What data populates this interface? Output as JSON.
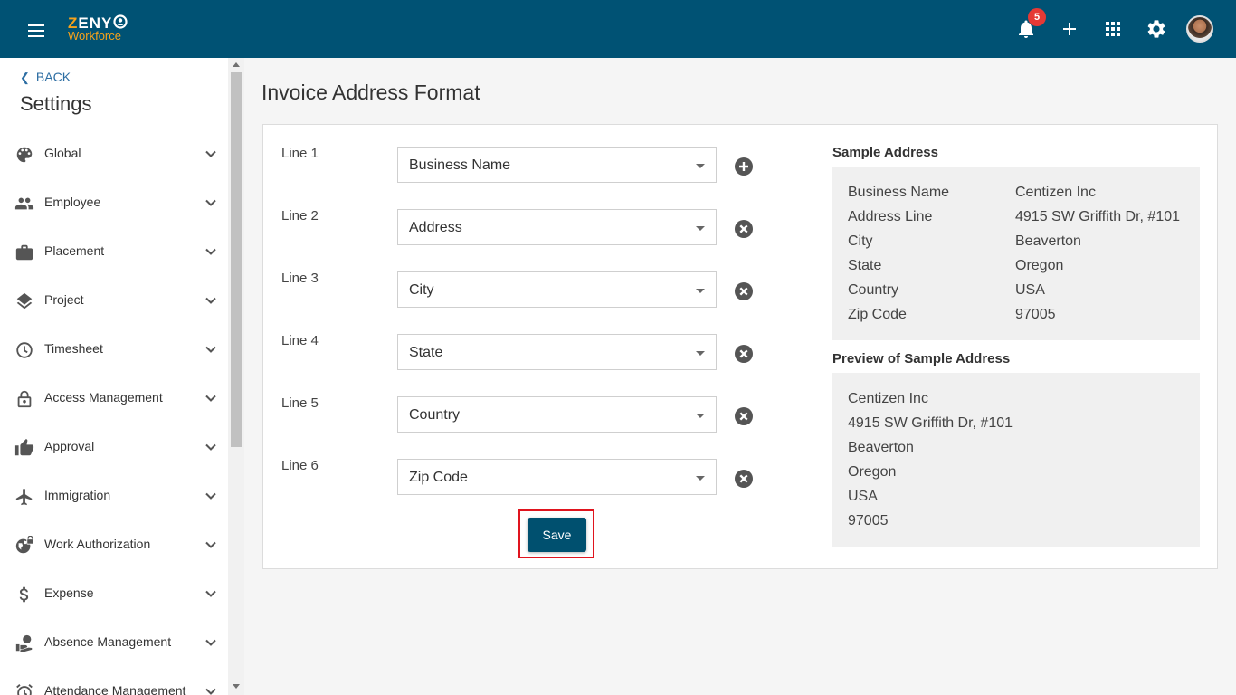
{
  "app": {
    "logo_top_first": "Z",
    "logo_top_rest": "ENY",
    "logo_bottom": "Workforce",
    "notification_count": "5",
    "icons": [
      "menu-icon",
      "bell-icon",
      "plus-icon",
      "apps-grid-icon",
      "gear-icon",
      "avatar"
    ]
  },
  "sidebar": {
    "back_label": "BACK",
    "title": "Settings",
    "items": [
      {
        "label": "Global",
        "icon": "palette-icon"
      },
      {
        "label": "Employee",
        "icon": "people-icon"
      },
      {
        "label": "Placement",
        "icon": "briefcase-icon"
      },
      {
        "label": "Project",
        "icon": "layers-icon"
      },
      {
        "label": "Timesheet",
        "icon": "clock-icon"
      },
      {
        "label": "Access Management",
        "icon": "lock-icon"
      },
      {
        "label": "Approval",
        "icon": "thumbs-up-icon"
      },
      {
        "label": "Immigration",
        "icon": "airplane-icon"
      },
      {
        "label": "Work Authorization",
        "icon": "globe-lock-icon"
      },
      {
        "label": "Expense",
        "icon": "dollar-icon"
      },
      {
        "label": "Absence Management",
        "icon": "person-leave-icon"
      },
      {
        "label": "Attendance Management",
        "icon": "alarm-icon"
      }
    ]
  },
  "main": {
    "title": "Invoice Address Format",
    "lines": [
      {
        "label": "Line 1",
        "value": "Business Name",
        "action": "add"
      },
      {
        "label": "Line 2",
        "value": "Address",
        "action": "remove"
      },
      {
        "label": "Line 3",
        "value": "City",
        "action": "remove"
      },
      {
        "label": "Line 4",
        "value": "State",
        "action": "remove"
      },
      {
        "label": "Line 5",
        "value": "Country",
        "action": "remove"
      },
      {
        "label": "Line 6",
        "value": "Zip Code",
        "action": "remove"
      }
    ],
    "save_label": "Save",
    "sample_title": "Sample Address",
    "sample": [
      {
        "key": "Business Name",
        "value": "Centizen Inc"
      },
      {
        "key": "Address Line",
        "value": "4915 SW Griffith Dr, #101"
      },
      {
        "key": "City",
        "value": "Beaverton"
      },
      {
        "key": "State",
        "value": "Oregon"
      },
      {
        "key": "Country",
        "value": "USA"
      },
      {
        "key": "Zip Code",
        "value": "97005"
      }
    ],
    "preview_title": "Preview of Sample Address",
    "preview": [
      "Centizen Inc",
      "4915 SW Griffith Dr, #101",
      "Beaverton",
      "Oregon",
      "USA",
      "97005"
    ]
  },
  "colors": {
    "topbar": "#005274",
    "accent": "#f6a21b",
    "link": "#2d6ea3",
    "save_button": "#00506f",
    "highlight": "#e0141e",
    "badge": "#e53935"
  }
}
